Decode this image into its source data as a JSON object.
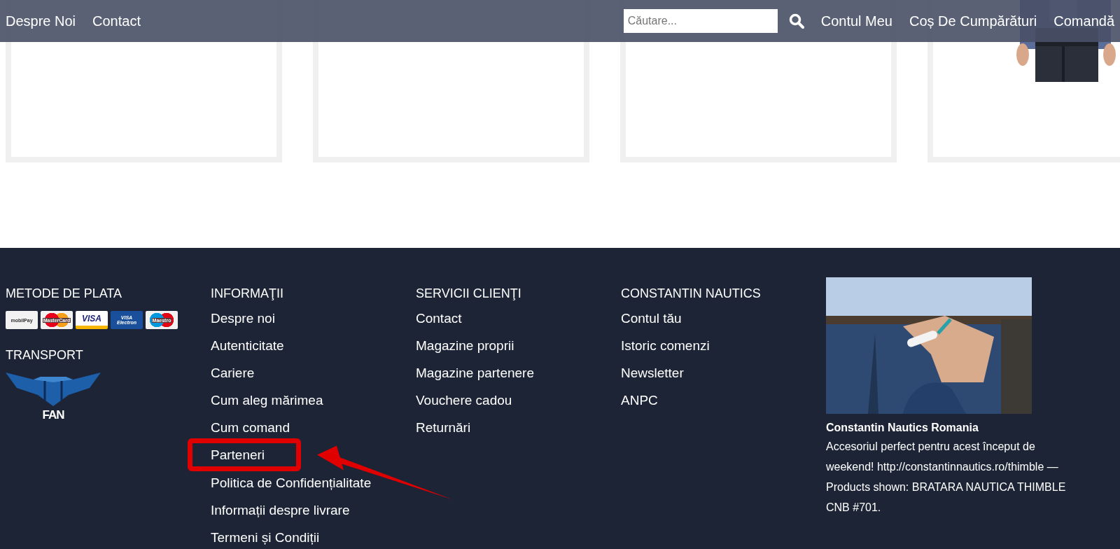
{
  "navbar": {
    "left_links": [
      "Despre Noi",
      "Contact"
    ],
    "search": {
      "placeholder": "Căutare..."
    },
    "right_links": [
      "Contul Meu",
      "Coș De Cumpărături",
      "Comandă"
    ]
  },
  "product_cards": [
    {
      "kind": "empty"
    },
    {
      "kind": "empty"
    },
    {
      "kind": "empty"
    },
    {
      "kind": "picture"
    }
  ],
  "footer": {
    "columns": [
      {
        "kind": "payment",
        "heading": "METODE DE PLATA",
        "logos": [
          {
            "kind": "mobilpay",
            "label": "mobilPay"
          },
          {
            "kind": "mastercard",
            "label": "MasterCard"
          },
          {
            "kind": "visa",
            "label": "VISA"
          },
          {
            "kind": "electron",
            "label": "VISA Electron"
          },
          {
            "kind": "maestro",
            "label": "Maestro"
          }
        ],
        "transport_heading": "TRANSPORT",
        "transport_logo": "FAN"
      },
      {
        "kind": "links",
        "heading": "INFORMAŢII",
        "links": [
          {
            "label": "Despre noi",
            "highlighted": false
          },
          {
            "label": "Autenticitate",
            "highlighted": false
          },
          {
            "label": "Cariere",
            "highlighted": false
          },
          {
            "label": "Cum aleg mărimea",
            "highlighted": false
          },
          {
            "label": "Cum comand",
            "highlighted": false
          },
          {
            "label": "Parteneri",
            "highlighted": true
          },
          {
            "label": "Politica de Confidențialitate",
            "highlighted": false
          },
          {
            "label": "Informații despre livrare",
            "highlighted": false
          },
          {
            "label": "Termeni și Condiții",
            "highlighted": false
          }
        ]
      },
      {
        "kind": "links",
        "heading": "SERVICII CLIENŢI",
        "links": [
          {
            "label": "Contact",
            "highlighted": false
          },
          {
            "label": "Magazine proprii",
            "highlighted": false
          },
          {
            "label": "Magazine partenere",
            "highlighted": false
          },
          {
            "label": "Vouchere cadou",
            "highlighted": false
          },
          {
            "label": "Returnări",
            "highlighted": false
          }
        ]
      },
      {
        "kind": "links",
        "heading": "CONSTANTIN NAUTICS",
        "links": [
          {
            "label": "Contul tău",
            "highlighted": false
          },
          {
            "label": "Istoric comenzi",
            "highlighted": false
          },
          {
            "label": "Newsletter",
            "highlighted": false
          },
          {
            "label": "ANPC",
            "highlighted": false
          }
        ]
      },
      {
        "kind": "post",
        "title": "Constantin Nautics Romania",
        "text": "Accesoriul perfect pentru acest început de weekend! http://constantinnautics.ro/thimble — Products shown: BRATARA NAUTICA THIMBLE CNB #701."
      }
    ]
  }
}
